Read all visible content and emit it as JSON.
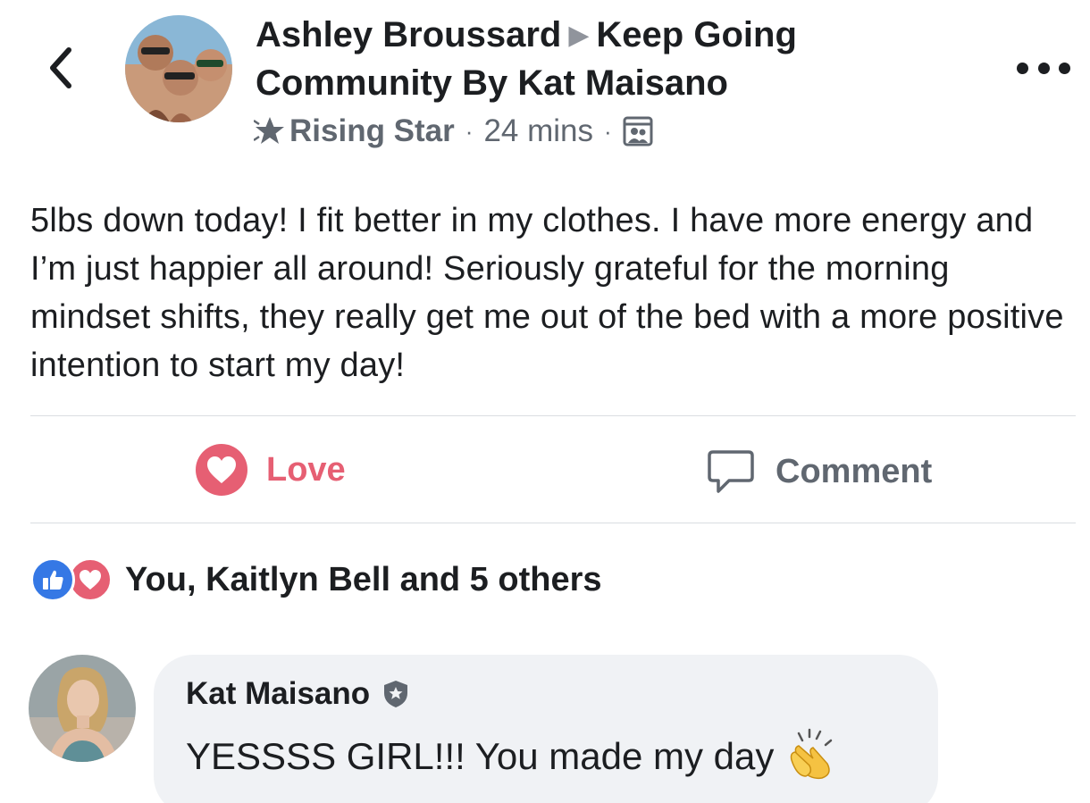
{
  "post": {
    "author": "Ashley Broussard",
    "group": "Keep Going Community By Kat Maisano",
    "badge": "Rising Star",
    "time": "24 mins",
    "body": "5lbs down today! I fit better in my clothes. I have more energy and I’m just happier all around! Seriously grateful for the morning mindset shifts, they really get me out of the bed with a more positive intention to start my day!"
  },
  "actions": {
    "love_label": "Love",
    "comment_label": "Comment"
  },
  "reactions": {
    "summary": "You, Kaitlyn Bell and 5 others"
  },
  "comment": {
    "author": "Kat Maisano",
    "text": "YESSSS GIRL!!! You made my day"
  },
  "icons": {
    "back": "chevron-left-icon",
    "more": "more-dots-icon",
    "badge": "star-badge-icon",
    "audience": "group-audience-icon",
    "love": "heart-icon",
    "comment": "comment-bubble-icon",
    "like_reaction": "thumbs-up-icon",
    "love_reaction": "heart-icon",
    "admin": "shield-star-icon",
    "emoji": "clapping-hands-icon"
  },
  "colors": {
    "love": "#e65f73",
    "like": "#3578e5",
    "muted": "#606770",
    "bubble": "#f0f2f5",
    "divider": "#dadde1"
  }
}
